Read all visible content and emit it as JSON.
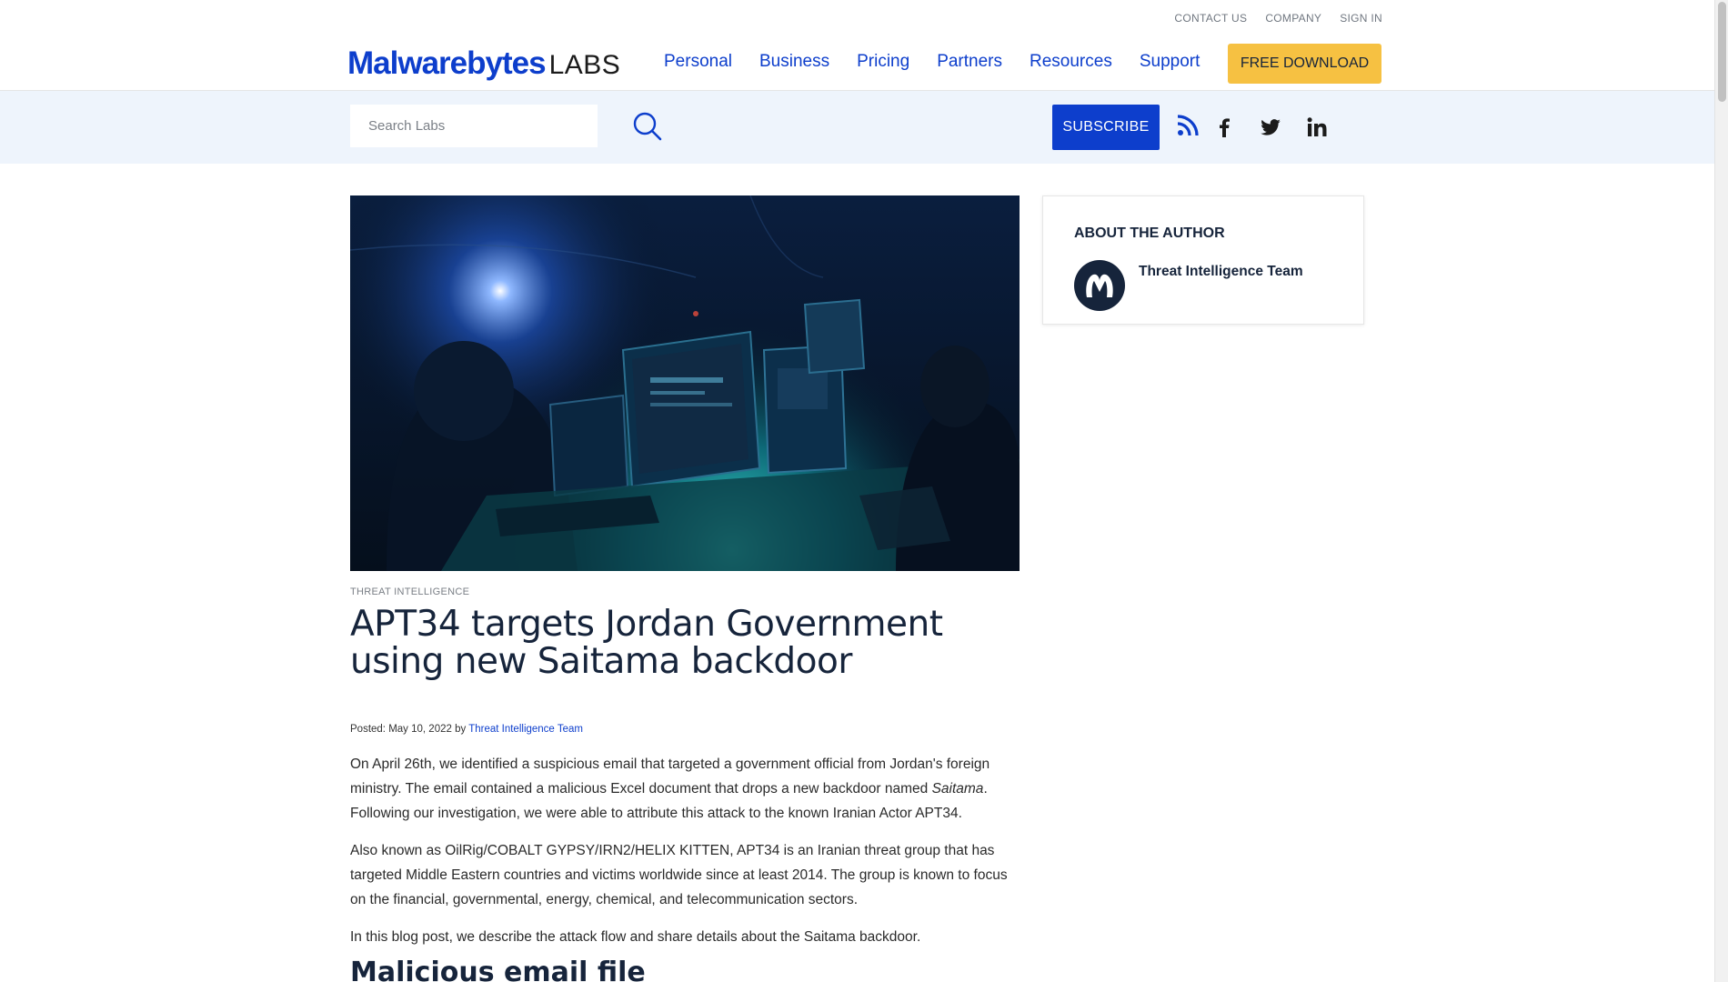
{
  "header": {
    "utility_links": [
      "CONTACT US",
      "COMPANY",
      "SIGN IN"
    ],
    "logo_main": "Malwarebytes",
    "logo_suffix": "LABS",
    "nav": [
      "Personal",
      "Business",
      "Pricing",
      "Partners",
      "Resources",
      "Support"
    ],
    "download_label": "FREE DOWNLOAD"
  },
  "subbar": {
    "search_placeholder": "Search Labs",
    "subscribe_label": "SUBSCRIBE",
    "social_icons": [
      "rss-icon",
      "facebook-icon",
      "twitter-icon",
      "linkedin-icon"
    ]
  },
  "article": {
    "category": "THREAT INTELLIGENCE",
    "title": "APT34 targets Jordan Government using new Saitama backdoor",
    "posted_prefix": "Posted: May 10, 2022 by ",
    "author_link": "Threat Intelligence Team",
    "p1_before": "On April 26th, we identified a suspicious email that targeted a government official from Jordan's foreign ministry. The email contained a malicious Excel document that drops a new backdoor named ",
    "p1_em": "Saitama",
    "p1_after": ". Following our investigation, we were able to attribute this attack to the known Iranian Actor APT34.",
    "p2": "Also known as OilRig/COBALT GYPSY/IRN2/HELIX KITTEN, APT34 is an Iranian threat group that has targeted Middle Eastern countries and victims worldwide since at least 2014. The group is known to focus on the financial, governmental, energy, chemical, and telecommunication sectors.",
    "p3": "In this blog post, we describe the attack flow and share details about the Saitama backdoor.",
    "section_heading": "Malicious email file"
  },
  "author_box": {
    "heading": "ABOUT THE AUTHOR",
    "name": "Threat Intelligence Team"
  },
  "colors": {
    "brand_blue": "#0d3ecc",
    "download_yellow": "#f6c142",
    "subbar_bg": "#eef4fc",
    "heading_navy": "#16243b"
  }
}
